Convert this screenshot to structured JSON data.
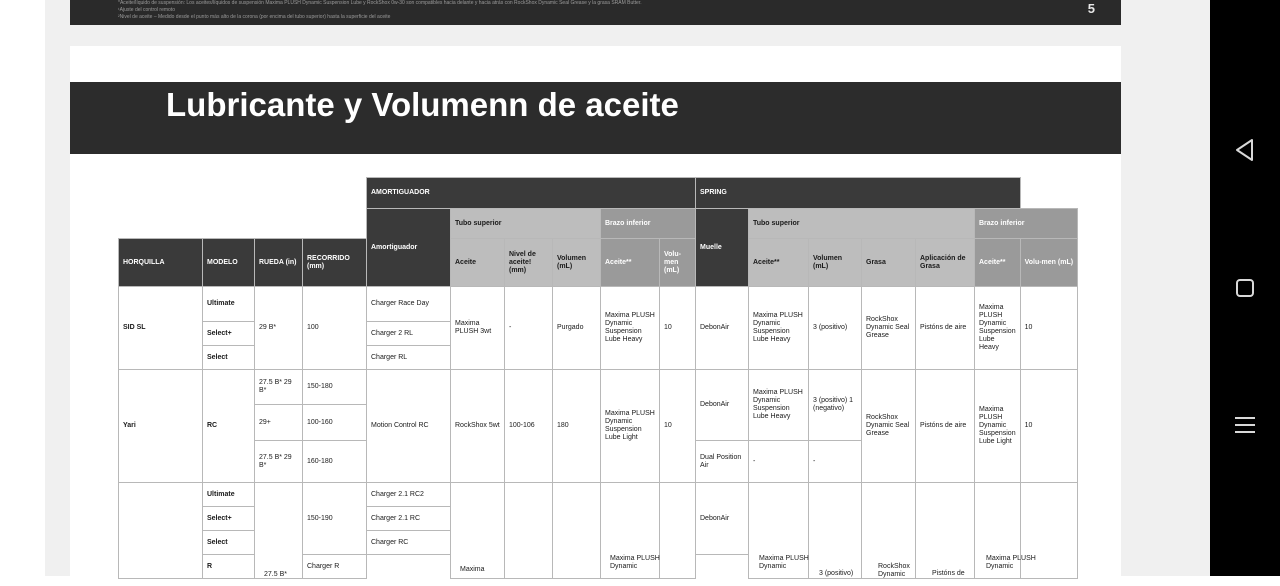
{
  "previous_page": {
    "footnotes": [
      "*Aceite/líquido de suspensión: Los aceites/líquidos de suspensión Maxima PLUSH Dynamic Suspension Lube y RockShox 0w-30 son compatibles hacia delante y hacia atrás con RockShox Dynamic Seal Grease y la grasa SRAM Butter.",
      "¹Ajuste del control remoto",
      "²Nivel de aceite – Medido desde el punto más alto de la corona (por encima del tubo superior) hasta la superficie del aceite"
    ],
    "page_number": "5"
  },
  "title": "Lubricante y Volumenn de aceite",
  "table": {
    "group_headers": {
      "amortiguador": "AMORTIGUADOR",
      "spring": "SPRING"
    },
    "sub_headers": {
      "amortiguador": "Amortiguador",
      "tubo_superior": "Tubo superior",
      "brazo_inferior": "Brazo inferior",
      "muelle": "Muelle",
      "tubo_superior_2": "Tubo superior",
      "brazo_inferior_2": "Brazo inferior"
    },
    "columns": {
      "horquilla": "HORQUILLA",
      "modelo": "MODELO",
      "rueda": "RUEDA (in)",
      "recorrido": "RECORRIDO (mm)",
      "aceite": "Aceite",
      "nivel": "Nivel de aceite! (mm)",
      "volumen": "Volumen (mL)",
      "aceite_bi": "Aceite**",
      "volumen_bi": "Volu-men (mL)",
      "aceite_s": "Aceite**",
      "volumen_s": "Volumen (mL)",
      "grasa": "Grasa",
      "aplicacion": "Aplicación de Grasa",
      "aceite_s_bi": "Aceite**",
      "volumen_s_bi": "Volu-men (mL)"
    },
    "sid": {
      "fork": "SID SL",
      "models": [
        "Ultimate",
        "Select+",
        "Select"
      ],
      "rueda": "29 B*",
      "recorrido": "100",
      "amortiguadores": [
        "Charger Race Day",
        "Charger 2 RL",
        "Charger RL"
      ],
      "aceite": "Maxima PLUSH 3wt",
      "nivel": "-",
      "volumen": "Purgado",
      "bi_aceite": "Maxima PLUSH Dynamic Suspension Lube Heavy",
      "bi_volumen": "10",
      "muelle": "DebonAir",
      "s_aceite": "Maxima PLUSH Dynamic Suspension Lube Heavy",
      "s_volumen": "3 (positivo)",
      "grasa": "RockShox Dynamic Seal Grease",
      "aplicacion": "Pistóns de aire",
      "s_bi_aceite": "Maxima PLUSH Dynamic Suspension Lube Heavy",
      "s_bi_volumen": "10"
    },
    "yari": {
      "fork": "Yari",
      "model": "RC",
      "ruedas": [
        "27.5 B* 29 B*",
        "29+",
        "27.5 B* 29 B*"
      ],
      "recorridos": [
        "150-180",
        "100-160",
        "160-180"
      ],
      "amortiguador": "Motion Control RC",
      "aceite": "RockShox 5wt",
      "nivel": "100-106",
      "volumen": "180",
      "bi_aceite": "Maxima PLUSH Dynamic Suspension Lube Light",
      "bi_volumen": "10",
      "muelles": [
        "DebonAir",
        "Dual Position Air"
      ],
      "s_aceite": "Maxima PLUSH Dynamic Suspension Lube Heavy",
      "s_aceite_2": "-",
      "s_volumen": "3 (positivo) 1 (negativo)",
      "s_volumen_2": "-",
      "grasa": "RockShox Dynamic Seal Grease",
      "aplicacion": "Pistóns de aire",
      "s_bi_aceite": "Maxima PLUSH Dynamic Suspension Lube Light",
      "s_bi_volumen": "10"
    },
    "third": {
      "fork": "???",
      "models": [
        "Ultimate",
        "Select+",
        "Select",
        "R"
      ],
      "rueda": "27.5 B*",
      "recorrido": "150-190",
      "amortiguadores": [
        "Charger 2.1 RC2",
        "Charger 2.1 RC",
        "Charger RC",
        "Charger R"
      ],
      "aceite": "Maxima",
      "muelle": "DebonAir",
      "bi_aceite": "Maxima PLUSH Dynamic",
      "s_aceite": "Maxima PLUSH Dynamic",
      "s_volumen": "3 (positivo)",
      "grasa": "RockShox Dynamic",
      "aplicacion": "Pistóns de",
      "s_bi_aceite": "Maxima PLUSH Dynamic"
    }
  },
  "nav": {
    "back": "back-icon",
    "home": "home-icon",
    "menu": "menu-icon"
  }
}
